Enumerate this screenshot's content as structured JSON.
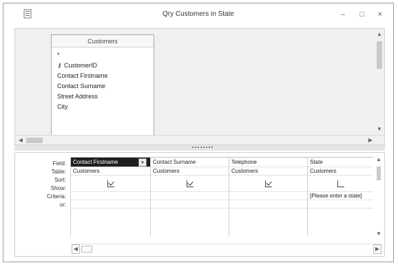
{
  "window": {
    "title": "Qry Customers in State",
    "icons": {
      "system": "query-icon",
      "minimize": "minimize-icon",
      "maximize": "maximize-icon",
      "close": "close-icon"
    },
    "buttons": {
      "minimize": "–",
      "maximize": "□",
      "close": "×"
    }
  },
  "table_pane": {
    "table_title": "Customers",
    "fields": [
      "*",
      "CustomerID",
      "Contact Firstname",
      "Contact Surname",
      "Street Address",
      "City"
    ],
    "key_field_index": 1
  },
  "design_grid": {
    "row_labels": [
      "Field:",
      "Table:",
      "Sort:",
      "Show:",
      "Criteria:",
      "or:"
    ],
    "columns": [
      {
        "field": "Contact Firstname",
        "table": "Customers",
        "show": true,
        "criteria": "",
        "selected": true
      },
      {
        "field": "Contact Surname",
        "table": "Customers",
        "show": true,
        "criteria": "",
        "selected": false
      },
      {
        "field": "Telephone",
        "table": "Customers",
        "show": true,
        "criteria": "",
        "selected": false
      },
      {
        "field": "State",
        "table": "Customers",
        "show": false,
        "criteria": "[Please enter a state]",
        "selected": false
      }
    ]
  }
}
